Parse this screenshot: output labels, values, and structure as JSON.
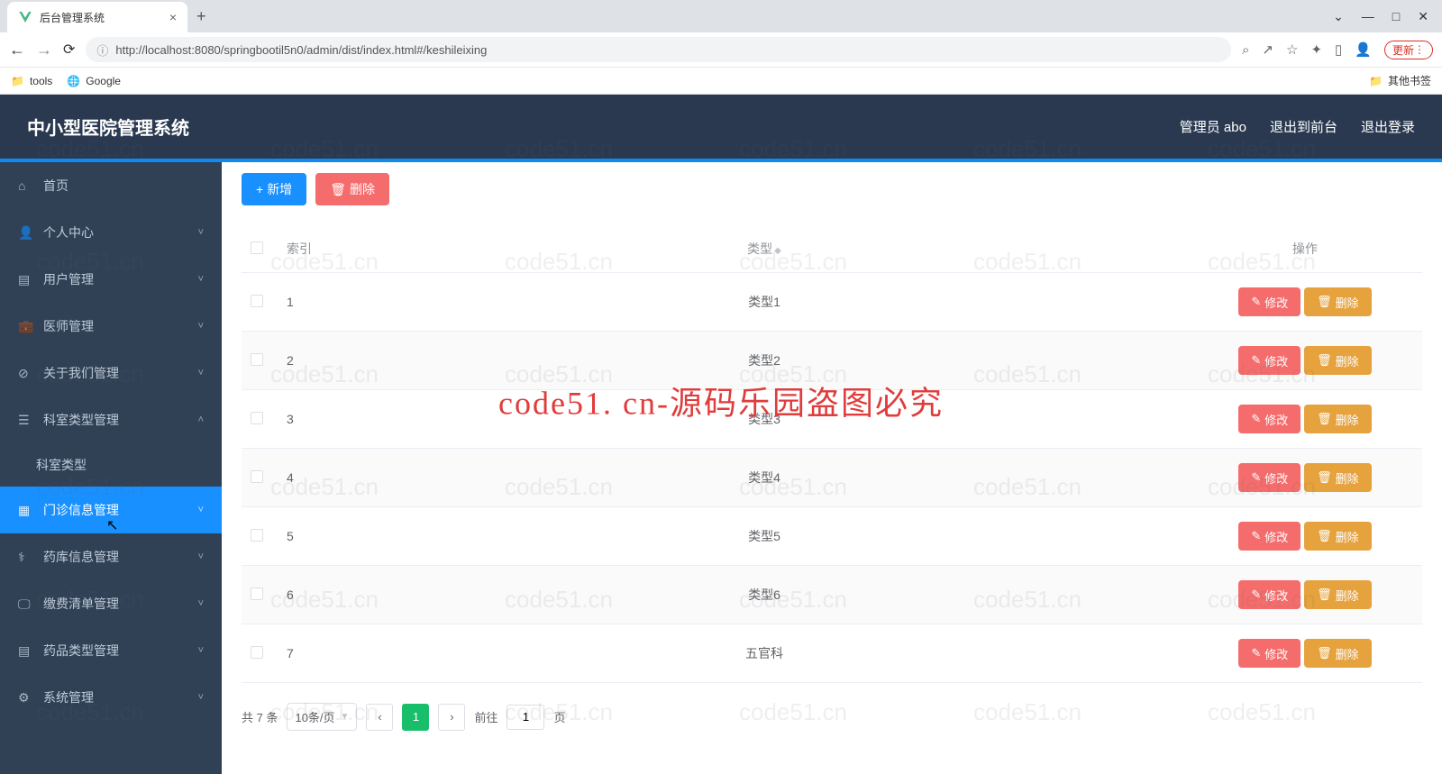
{
  "browser": {
    "tab_title": "后台管理系统",
    "url": "http://localhost:8080/springbootil5n0/admin/dist/index.html#/keshileixing",
    "url_host": "localhost",
    "bookmarks": {
      "tools": "tools",
      "google": "Google",
      "other": "其他书签"
    },
    "update_label": "更新"
  },
  "header": {
    "title": "中小型医院管理系统",
    "user_label": "管理员 abo",
    "exit_front": "退出到前台",
    "logout": "退出登录"
  },
  "sidebar": {
    "items": [
      {
        "label": "首页",
        "icon": "home",
        "expand": false
      },
      {
        "label": "个人中心",
        "icon": "user",
        "expand": true
      },
      {
        "label": "用户管理",
        "icon": "bars",
        "expand": true
      },
      {
        "label": "医师管理",
        "icon": "briefcase",
        "expand": true
      },
      {
        "label": "关于我们管理",
        "icon": "circle",
        "expand": true
      },
      {
        "label": "科室类型管理",
        "icon": "list",
        "expand": true,
        "open": true,
        "sub": "科室类型"
      },
      {
        "label": "门诊信息管理",
        "icon": "file",
        "expand": true,
        "active": true
      },
      {
        "label": "药库信息管理",
        "icon": "user2",
        "expand": true
      },
      {
        "label": "缴费清单管理",
        "icon": "monitor",
        "expand": true
      },
      {
        "label": "药品类型管理",
        "icon": "list2",
        "expand": true
      },
      {
        "label": "系统管理",
        "icon": "gear",
        "expand": true
      }
    ]
  },
  "toolbar": {
    "add_label": "新增",
    "delete_label": "删除"
  },
  "table": {
    "headers": {
      "index": "索引",
      "type": "类型",
      "action": "操作"
    },
    "edit_label": "修改",
    "delete_label": "删除",
    "rows": [
      {
        "index": "1",
        "type": "类型1"
      },
      {
        "index": "2",
        "type": "类型2"
      },
      {
        "index": "3",
        "type": "类型3"
      },
      {
        "index": "4",
        "type": "类型4"
      },
      {
        "index": "5",
        "type": "类型5"
      },
      {
        "index": "6",
        "type": "类型6"
      },
      {
        "index": "7",
        "type": "五官科"
      }
    ]
  },
  "pagination": {
    "total": "共 7 条",
    "per_page": "10条/页",
    "current": "1",
    "goto_label": "前往",
    "page_suffix": "页",
    "goto_value": "1"
  },
  "watermark": "code51. cn-源码乐园盗图必究",
  "wm_small": "code51.cn"
}
